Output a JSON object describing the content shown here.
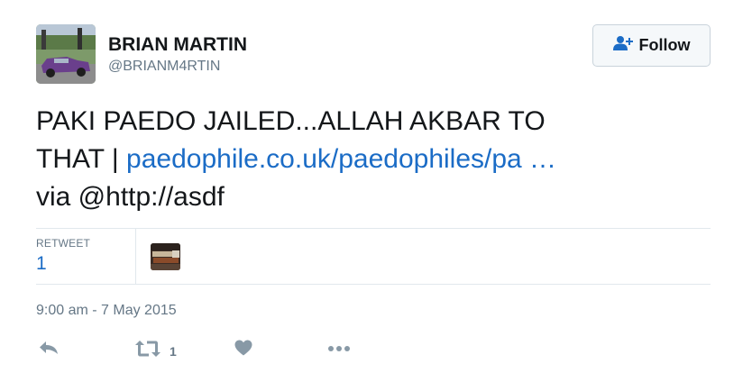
{
  "user": {
    "display_name": "BRIAN MARTIN",
    "handle": "@BRIANM4RTIN"
  },
  "follow_button": {
    "label": "Follow",
    "icon": "add-user-icon"
  },
  "tweet": {
    "line1": "PAKI PAEDO JAILED...ALLAH AKBAR TO",
    "line2_prefix": "THAT | ",
    "link_text": "paedophile.co.uk/paedophiles/pa …",
    "line3": "via @http://asdf"
  },
  "stats": {
    "retweet_label": "RETWEET",
    "retweet_count": "1"
  },
  "timestamp": "9:00 am - 7 May 2015",
  "actions": {
    "reply_icon": "reply-icon",
    "retweet_icon": "retweet-icon",
    "retweet_count": "1",
    "like_icon": "heart-icon",
    "more_icon": "more-icon"
  },
  "colors": {
    "link": "#1b6cc6",
    "muted": "#657786",
    "text": "#14171a",
    "divider": "#e1e8ed"
  }
}
